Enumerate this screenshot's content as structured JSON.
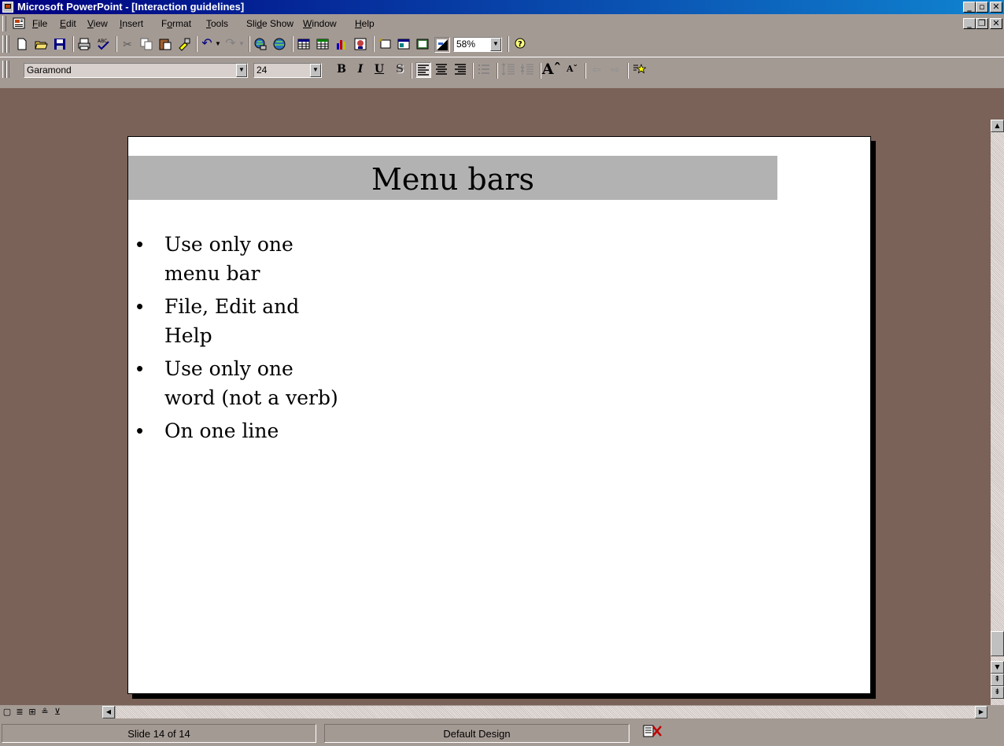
{
  "window": {
    "title": "Microsoft PowerPoint - [Interaction guidelines]"
  },
  "menu": [
    "File",
    "Edit",
    "View",
    "Insert",
    "Format",
    "Tools",
    "Slide Show",
    "Window",
    "Help"
  ],
  "menu_access_keys": [
    "F",
    "E",
    "V",
    "I",
    "o",
    "T",
    "d",
    "W",
    "H"
  ],
  "toolbar": {
    "zoom": "58%"
  },
  "formatting": {
    "font": "Garamond",
    "size": "24",
    "bold": "B",
    "italic": "I",
    "underline": "U",
    "shadow": "S"
  },
  "slide": {
    "title": "Menu bars",
    "bullets": [
      {
        "line1": "Use only one",
        "line2": "menu bar"
      },
      {
        "line1": "File, Edit and",
        "line2": "Help"
      },
      {
        "line1": "Use only one",
        "line2": "word (not a verb)"
      },
      {
        "line1": "On one line",
        "line2": ""
      }
    ]
  },
  "status": {
    "slide": "Slide 14 of 14",
    "design": "Default Design"
  },
  "colors": {
    "title_bar": "#000080",
    "background": "#7a6258",
    "chrome": "#a49a94",
    "slide_title_band": "#b2b2b2"
  }
}
